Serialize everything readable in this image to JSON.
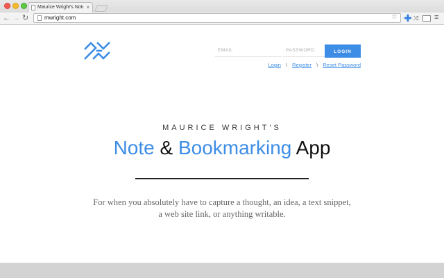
{
  "browser": {
    "tab_title": "Maurice Wright's Note and",
    "tab_close": "×",
    "url": "mwright.com",
    "icons": {
      "back": "arrow-left-icon",
      "forward": "arrow-right-icon",
      "reload": "reload-icon",
      "bookmark": "star-icon",
      "extension_add": "plus-icon",
      "extension_tools": "tools-icon",
      "extension_mail": "mail-icon",
      "menu": "hamburger-menu-icon"
    }
  },
  "header": {
    "logo": "mw-logo",
    "email_placeholder": "EMAIL",
    "password_placeholder": "PASSWORD",
    "login_button": "LOGIN",
    "links": {
      "login": "Login",
      "register": "Register",
      "reset": "Reset Password",
      "separator": "\\"
    }
  },
  "hero": {
    "kicker": "MAURICE WRIGHT'S",
    "title_word1": "Note",
    "title_amp": " & ",
    "title_word2": "Bookmarking",
    "title_word3": " App",
    "tagline": "For when you absolutely have to capture a thought, an idea, a text snippet, a web site link, or anything writable."
  },
  "colors": {
    "accent": "#3d8de6",
    "text": "#111111",
    "muted": "#666666",
    "footer": "#d3d3d3"
  }
}
